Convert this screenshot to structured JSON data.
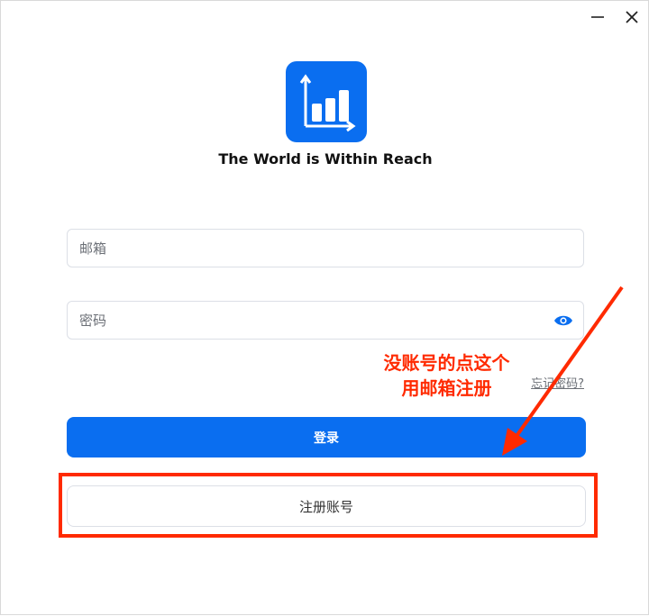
{
  "window": {
    "controls": {
      "minimize_icon": "minimize-icon",
      "close_icon": "close-icon"
    }
  },
  "app": {
    "tagline": "The World is Within Reach",
    "logo_icon": "bar-chart-icon"
  },
  "form": {
    "email_placeholder": "邮箱",
    "password_placeholder": "密码",
    "forgot_link": "忘记密码?",
    "login_label": "登录",
    "register_label": "注册账号"
  },
  "annotation": {
    "line1": "没账号的点这个",
    "line2": "用邮箱注册",
    "color": "#ff2a00"
  },
  "colors": {
    "accent": "#0a6ef0"
  }
}
